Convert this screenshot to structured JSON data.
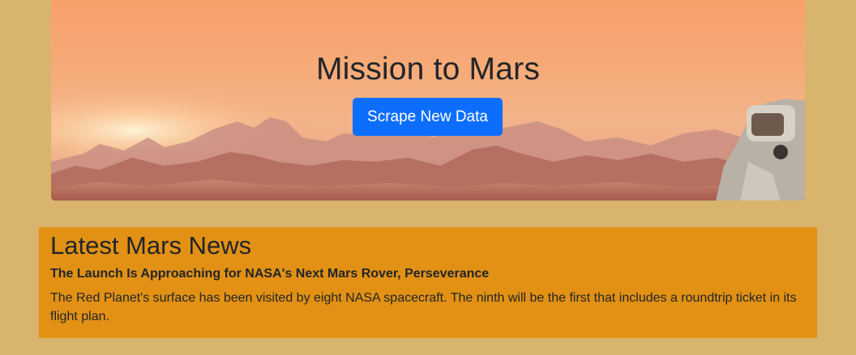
{
  "hero": {
    "title": "Mission to Mars",
    "button_label": "Scrape New Data"
  },
  "news": {
    "heading": "Latest Mars News",
    "title": "The Launch Is Approaching for NASA's Next Mars Rover, Perseverance",
    "teaser": "The Red Planet's surface has been visited by eight NASA spacecraft. The ninth will be the first that includes a roundtrip ticket in its flight plan."
  },
  "colors": {
    "page_background": "#d8b46d",
    "news_background": "#e29115",
    "button": "#0d6efd"
  }
}
